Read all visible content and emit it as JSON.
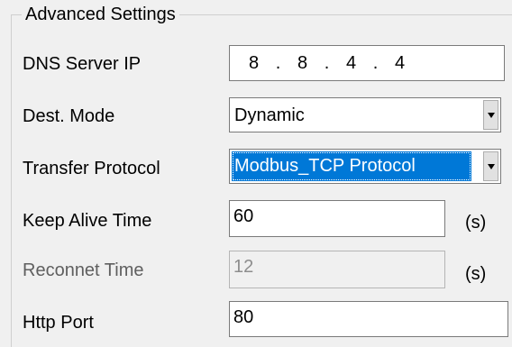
{
  "group_title": "Advanced Settings",
  "dns": {
    "label": "DNS Server IP",
    "octets": [
      "8",
      "8",
      "4",
      "4"
    ],
    "separator": "."
  },
  "dest_mode": {
    "label": "Dest. Mode",
    "value": "Dynamic"
  },
  "transfer_protocol": {
    "label": "Transfer Protocol",
    "value": "Modbus_TCP Protocol"
  },
  "keep_alive": {
    "label": "Keep Alive Time",
    "value": "60",
    "unit": "(s)"
  },
  "reconnect": {
    "label": "Reconnet Time",
    "value": "12",
    "unit": "(s)"
  },
  "http_port": {
    "label": "Http Port",
    "value": "80"
  },
  "icons": {
    "dropdown": "chevron-down-icon"
  }
}
